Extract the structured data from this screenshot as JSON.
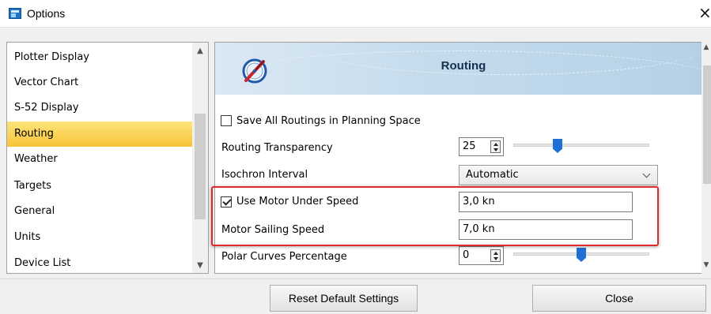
{
  "window": {
    "title": "Options"
  },
  "sidebar": {
    "items": [
      {
        "label": "Plotter Display",
        "selected": false
      },
      {
        "label": "Vector Chart",
        "selected": false
      },
      {
        "label": "S-52 Display",
        "selected": false
      },
      {
        "label": "Routing",
        "selected": true
      },
      {
        "label": "Weather",
        "selected": false
      },
      {
        "label": "Targets",
        "selected": false
      },
      {
        "label": "General",
        "selected": false
      },
      {
        "label": "Units",
        "selected": false
      },
      {
        "label": "Device List",
        "selected": false
      }
    ]
  },
  "panel": {
    "title": "Routing",
    "save_all": {
      "label": "Save All Routings in Planning Space",
      "checked": false
    },
    "transparency": {
      "label": "Routing Transparency",
      "value": "25"
    },
    "isochron": {
      "label": "Isochron Interval",
      "value": "Automatic"
    },
    "motor_under": {
      "label": "Use Motor Under Speed",
      "checked": true,
      "value": "3,0 kn"
    },
    "motor_sailing": {
      "label": "Motor Sailing Speed",
      "value": "7,0 kn"
    },
    "polar": {
      "label": "Polar Curves Percentage",
      "value": "0"
    }
  },
  "footer": {
    "reset_label": "Reset Default Settings",
    "close_label": "Close"
  },
  "colors": {
    "selected_item": "#f8c437",
    "highlight_border": "#dd2b2b",
    "slider_thumb": "#1f6fd4"
  }
}
